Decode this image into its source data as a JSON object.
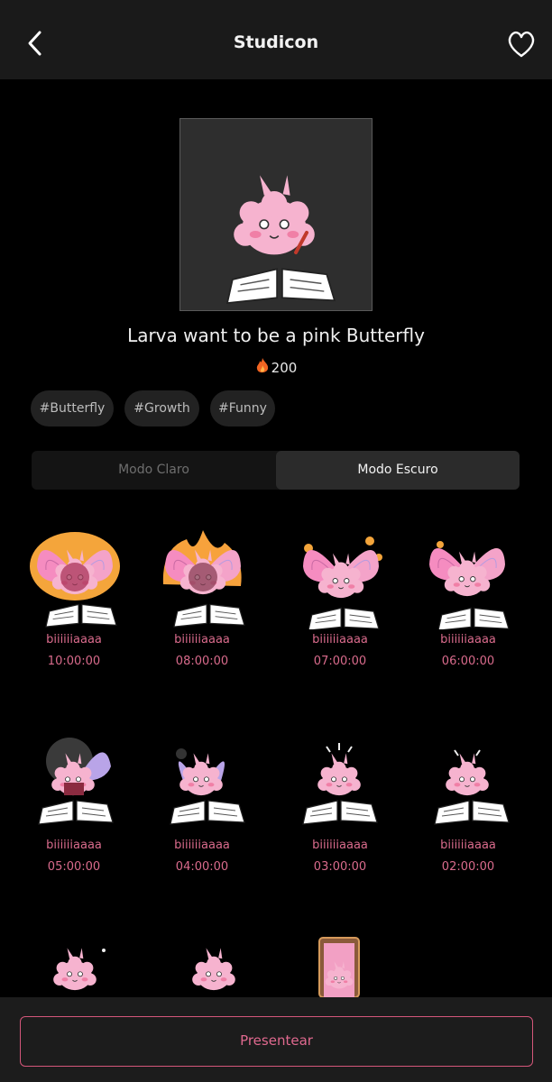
{
  "header": {
    "title": "Studicon",
    "back_icon": "chevron-left-icon",
    "favorite_icon": "heart-outline-icon"
  },
  "pack": {
    "name": "Larva want to be a pink Butterfly",
    "price": "200",
    "price_icon": "flame-icon"
  },
  "tags": [
    "#Butterfly",
    "#Growth",
    "#Funny"
  ],
  "modes": {
    "light": "Modo Claro",
    "dark": "Modo Escuro",
    "selected": "dark"
  },
  "stickers": [
    {
      "name": "biiiiiiaaaa",
      "time": "10:00:00"
    },
    {
      "name": "biiiiiiaaaa",
      "time": "08:00:00"
    },
    {
      "name": "biiiiiiaaaa",
      "time": "07:00:00"
    },
    {
      "name": "biiiiiiaaaa",
      "time": "06:00:00"
    },
    {
      "name": "biiiiiiaaaa",
      "time": "05:00:00"
    },
    {
      "name": "biiiiiiaaaa",
      "time": "04:00:00"
    },
    {
      "name": "biiiiiiaaaa",
      "time": "03:00:00"
    },
    {
      "name": "biiiiiiaaaa",
      "time": "02:00:00"
    }
  ],
  "footer": {
    "button": "Presentear"
  },
  "colors": {
    "accent": "#d96b8c",
    "background": "#000000",
    "panel": "#1a1a1a"
  }
}
